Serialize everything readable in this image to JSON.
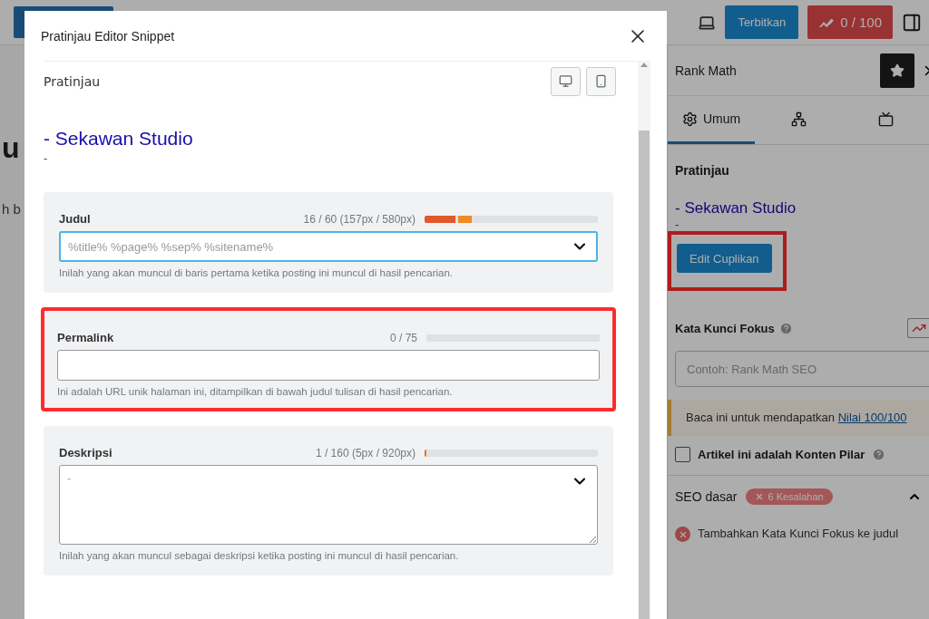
{
  "editor": {
    "heading": "u",
    "paragraph": "h b"
  },
  "topbar": {
    "publish_button": "Terbitkan",
    "score_button": "0 / 100"
  },
  "sidebar": {
    "title": "Rank Math",
    "tabs": [
      {
        "kind": "gear",
        "label": "Umum",
        "selected": true
      },
      {
        "kind": "network",
        "selected": false
      },
      {
        "kind": "screen",
        "selected": false
      }
    ],
    "preview_heading": "Pratinjau",
    "preview_title": "- Sekawan Studio",
    "preview_description": "-",
    "edit_button": {
      "label": "Edit Cuplikan",
      "highlighted": true
    },
    "focus_keyword": {
      "label": "Kata Kunci Fokus",
      "placeholder": "Contoh: Rank Math SEO"
    },
    "notice": {
      "text": "Baca ini untuk mendapatkan",
      "link": "Nilai 100/100"
    },
    "pillar": {
      "label": "Artikel ini adalah Konten Pilar",
      "checked": false
    },
    "seo_section": {
      "title": "SEO dasar",
      "badge": "6 Kesalahan",
      "expanded": true,
      "items": [
        {
          "text": "Tambahkan Kata Kunci Fokus ke judul",
          "passed": false
        }
      ]
    }
  },
  "modal": {
    "title": "Pratinjau Editor Snippet",
    "preview": {
      "heading": "Pratinjau",
      "title": "- Sekawan Studio",
      "description": "-"
    },
    "fields": [
      {
        "kind": "select",
        "label": "Judul",
        "counter": "16 / 60 (157px / 580px)",
        "level": 0.27,
        "placeholder": "%title% %page% %sep% %sitename%",
        "hint": "Inilah yang akan muncul di baris pertama ketika posting ini muncul di hasil pencarian.",
        "focused": true,
        "highlighted": false
      },
      {
        "kind": "input",
        "label": "Permalink",
        "counter": "0 / 75",
        "level": 0,
        "hint": "Ini adalah URL unik halaman ini, ditampilkan di bawah judul tulisan di hasil pencarian.",
        "focused": false,
        "highlighted": true
      },
      {
        "kind": "textarea",
        "label": "Deskripsi",
        "counter": "1 / 160 (5px / 920px)",
        "level": 0.01,
        "placeholder": "-",
        "hint": "Inilah yang akan muncul sebagai deskripsi ketika posting ini muncul di hasil pencarian.",
        "focused": false,
        "highlighted": false
      }
    ]
  }
}
